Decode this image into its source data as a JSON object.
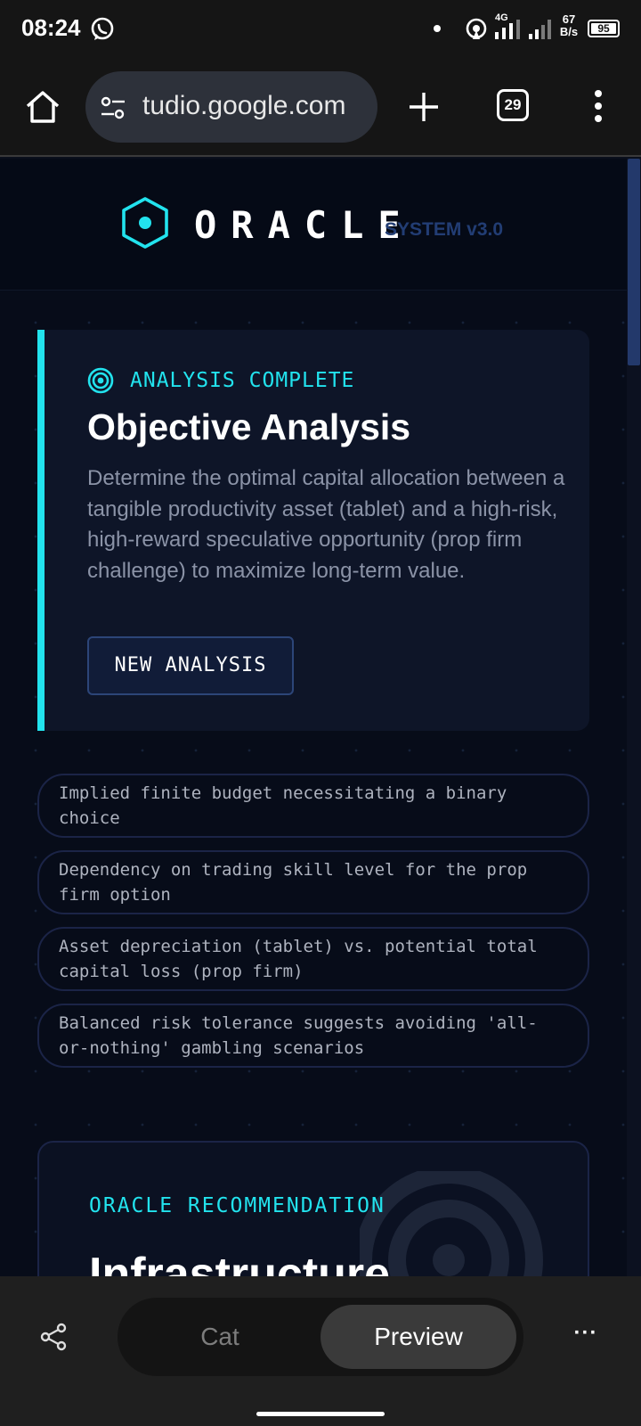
{
  "status_bar": {
    "time": "08:24",
    "network": "4G",
    "speed_value": "67",
    "speed_unit": "B/s",
    "battery": "95"
  },
  "browser": {
    "url": "tudio.google.com",
    "tab_count": "29"
  },
  "app": {
    "logo_word": "ORACLE",
    "logo_version": "SYSTEM v3.0",
    "accent_color": "#22e3ee"
  },
  "analysis": {
    "tag": "ANALYSIS COMPLETE",
    "title": "Objective Analysis",
    "description": "Determine the optimal capital allocation between a tangible productivity asset (tablet) and a high-risk, high-reward speculative opportunity (prop firm challenge) to maximize long-term value.",
    "button_label": "NEW ANALYSIS"
  },
  "facts": [
    "Implied finite budget necessitating a binary choice",
    "Dependency on trading skill level for the prop firm option",
    "Asset depreciation (tablet) vs. potential total capital loss (prop firm)",
    "Balanced risk tolerance suggests avoiding 'all-or-nothing' gambling scenarios"
  ],
  "recommendation": {
    "tag": "ORACLE RECOMMENDATION",
    "title": "Infrastructure"
  },
  "bottom_bar": {
    "tab_cat": "Cat",
    "tab_preview": "Preview",
    "active_tab": "Preview",
    "more": "···"
  }
}
